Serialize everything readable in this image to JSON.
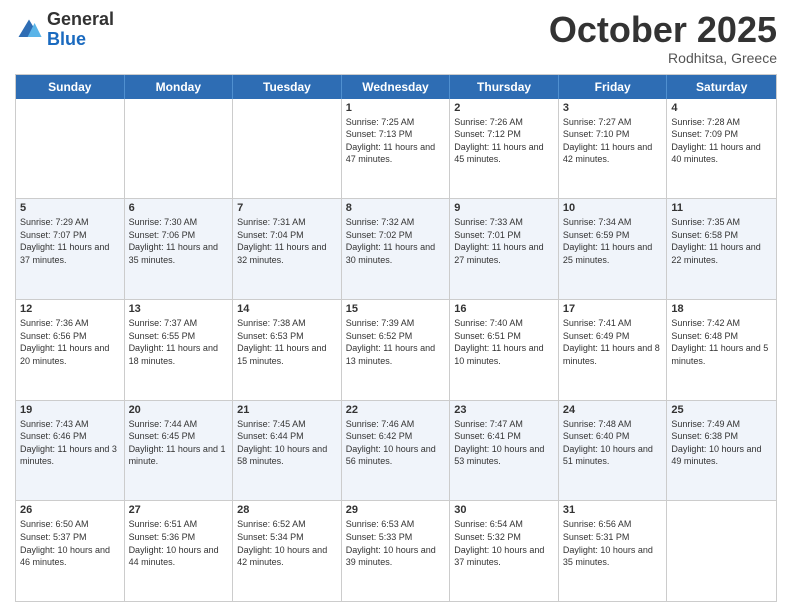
{
  "logo": {
    "general": "General",
    "blue": "Blue"
  },
  "title": "October 2025",
  "subtitle": "Rodhitsa, Greece",
  "weekdays": [
    "Sunday",
    "Monday",
    "Tuesday",
    "Wednesday",
    "Thursday",
    "Friday",
    "Saturday"
  ],
  "rows": [
    {
      "alt": false,
      "cells": [
        {
          "day": "",
          "text": ""
        },
        {
          "day": "",
          "text": ""
        },
        {
          "day": "",
          "text": ""
        },
        {
          "day": "1",
          "text": "Sunrise: 7:25 AM\nSunset: 7:13 PM\nDaylight: 11 hours and 47 minutes."
        },
        {
          "day": "2",
          "text": "Sunrise: 7:26 AM\nSunset: 7:12 PM\nDaylight: 11 hours and 45 minutes."
        },
        {
          "day": "3",
          "text": "Sunrise: 7:27 AM\nSunset: 7:10 PM\nDaylight: 11 hours and 42 minutes."
        },
        {
          "day": "4",
          "text": "Sunrise: 7:28 AM\nSunset: 7:09 PM\nDaylight: 11 hours and 40 minutes."
        }
      ]
    },
    {
      "alt": true,
      "cells": [
        {
          "day": "5",
          "text": "Sunrise: 7:29 AM\nSunset: 7:07 PM\nDaylight: 11 hours and 37 minutes."
        },
        {
          "day": "6",
          "text": "Sunrise: 7:30 AM\nSunset: 7:06 PM\nDaylight: 11 hours and 35 minutes."
        },
        {
          "day": "7",
          "text": "Sunrise: 7:31 AM\nSunset: 7:04 PM\nDaylight: 11 hours and 32 minutes."
        },
        {
          "day": "8",
          "text": "Sunrise: 7:32 AM\nSunset: 7:02 PM\nDaylight: 11 hours and 30 minutes."
        },
        {
          "day": "9",
          "text": "Sunrise: 7:33 AM\nSunset: 7:01 PM\nDaylight: 11 hours and 27 minutes."
        },
        {
          "day": "10",
          "text": "Sunrise: 7:34 AM\nSunset: 6:59 PM\nDaylight: 11 hours and 25 minutes."
        },
        {
          "day": "11",
          "text": "Sunrise: 7:35 AM\nSunset: 6:58 PM\nDaylight: 11 hours and 22 minutes."
        }
      ]
    },
    {
      "alt": false,
      "cells": [
        {
          "day": "12",
          "text": "Sunrise: 7:36 AM\nSunset: 6:56 PM\nDaylight: 11 hours and 20 minutes."
        },
        {
          "day": "13",
          "text": "Sunrise: 7:37 AM\nSunset: 6:55 PM\nDaylight: 11 hours and 18 minutes."
        },
        {
          "day": "14",
          "text": "Sunrise: 7:38 AM\nSunset: 6:53 PM\nDaylight: 11 hours and 15 minutes."
        },
        {
          "day": "15",
          "text": "Sunrise: 7:39 AM\nSunset: 6:52 PM\nDaylight: 11 hours and 13 minutes."
        },
        {
          "day": "16",
          "text": "Sunrise: 7:40 AM\nSunset: 6:51 PM\nDaylight: 11 hours and 10 minutes."
        },
        {
          "day": "17",
          "text": "Sunrise: 7:41 AM\nSunset: 6:49 PM\nDaylight: 11 hours and 8 minutes."
        },
        {
          "day": "18",
          "text": "Sunrise: 7:42 AM\nSunset: 6:48 PM\nDaylight: 11 hours and 5 minutes."
        }
      ]
    },
    {
      "alt": true,
      "cells": [
        {
          "day": "19",
          "text": "Sunrise: 7:43 AM\nSunset: 6:46 PM\nDaylight: 11 hours and 3 minutes."
        },
        {
          "day": "20",
          "text": "Sunrise: 7:44 AM\nSunset: 6:45 PM\nDaylight: 11 hours and 1 minute."
        },
        {
          "day": "21",
          "text": "Sunrise: 7:45 AM\nSunset: 6:44 PM\nDaylight: 10 hours and 58 minutes."
        },
        {
          "day": "22",
          "text": "Sunrise: 7:46 AM\nSunset: 6:42 PM\nDaylight: 10 hours and 56 minutes."
        },
        {
          "day": "23",
          "text": "Sunrise: 7:47 AM\nSunset: 6:41 PM\nDaylight: 10 hours and 53 minutes."
        },
        {
          "day": "24",
          "text": "Sunrise: 7:48 AM\nSunset: 6:40 PM\nDaylight: 10 hours and 51 minutes."
        },
        {
          "day": "25",
          "text": "Sunrise: 7:49 AM\nSunset: 6:38 PM\nDaylight: 10 hours and 49 minutes."
        }
      ]
    },
    {
      "alt": false,
      "cells": [
        {
          "day": "26",
          "text": "Sunrise: 6:50 AM\nSunset: 5:37 PM\nDaylight: 10 hours and 46 minutes."
        },
        {
          "day": "27",
          "text": "Sunrise: 6:51 AM\nSunset: 5:36 PM\nDaylight: 10 hours and 44 minutes."
        },
        {
          "day": "28",
          "text": "Sunrise: 6:52 AM\nSunset: 5:34 PM\nDaylight: 10 hours and 42 minutes."
        },
        {
          "day": "29",
          "text": "Sunrise: 6:53 AM\nSunset: 5:33 PM\nDaylight: 10 hours and 39 minutes."
        },
        {
          "day": "30",
          "text": "Sunrise: 6:54 AM\nSunset: 5:32 PM\nDaylight: 10 hours and 37 minutes."
        },
        {
          "day": "31",
          "text": "Sunrise: 6:56 AM\nSunset: 5:31 PM\nDaylight: 10 hours and 35 minutes."
        },
        {
          "day": "",
          "text": ""
        }
      ]
    }
  ]
}
